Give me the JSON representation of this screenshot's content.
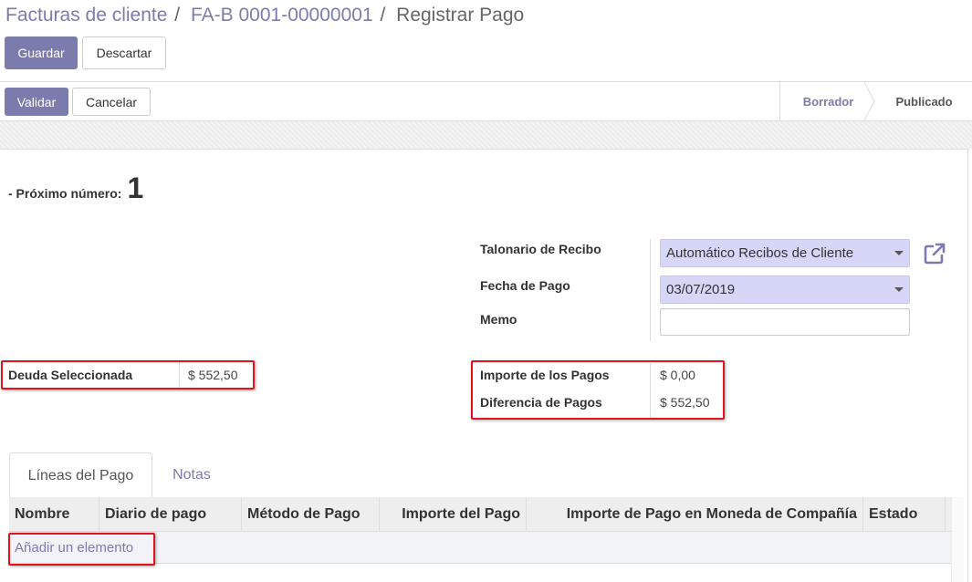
{
  "breadcrumb": {
    "items": [
      "Facturas de cliente",
      "FA-B 0001-00000001"
    ],
    "separator": "/",
    "current": "Registrar Pago"
  },
  "control_panel": {
    "save_label": "Guardar",
    "discard_label": "Descartar"
  },
  "form_header": {
    "validate_label": "Validar",
    "cancel_label": "Cancelar",
    "statusbar": [
      "Borrador",
      "Publicado"
    ],
    "active_status": "Borrador"
  },
  "form": {
    "next_number_label": "- Próximo número:",
    "next_number_value": "1",
    "fields": {
      "receipt_book_label": "Talonario de Recibo",
      "receipt_book_value": "Automático Recibos de Cliente",
      "payment_date_label": "Fecha de Pago",
      "payment_date_value": "03/07/2019",
      "memo_label": "Memo",
      "memo_value": ""
    },
    "selected_debt_label": "Deuda Seleccionada",
    "selected_debt_value": "$ 552,50",
    "payments_amount_label": "Importe de los Pagos",
    "payments_amount_value": "$ 0,00",
    "payments_diff_label": "Diferencia de Pagos",
    "payments_diff_value": "$ 552,50"
  },
  "tabs": [
    {
      "label": "Líneas del Pago",
      "active": true
    },
    {
      "label": "Notas",
      "active": false
    }
  ],
  "table": {
    "columns": [
      "Nombre",
      "Diario de pago",
      "Método de Pago",
      "Importe del Pago",
      "Importe de Pago en Moneda de Compañía",
      "Estado"
    ],
    "add_label": "Añadir un elemento"
  },
  "colors": {
    "accent": "#7c7bad",
    "highlight_border": "#e0141e",
    "select_bg": "#d6d6f7"
  },
  "icons": {
    "external_link": "external-link-icon",
    "dropdown": "caret-down-icon"
  }
}
